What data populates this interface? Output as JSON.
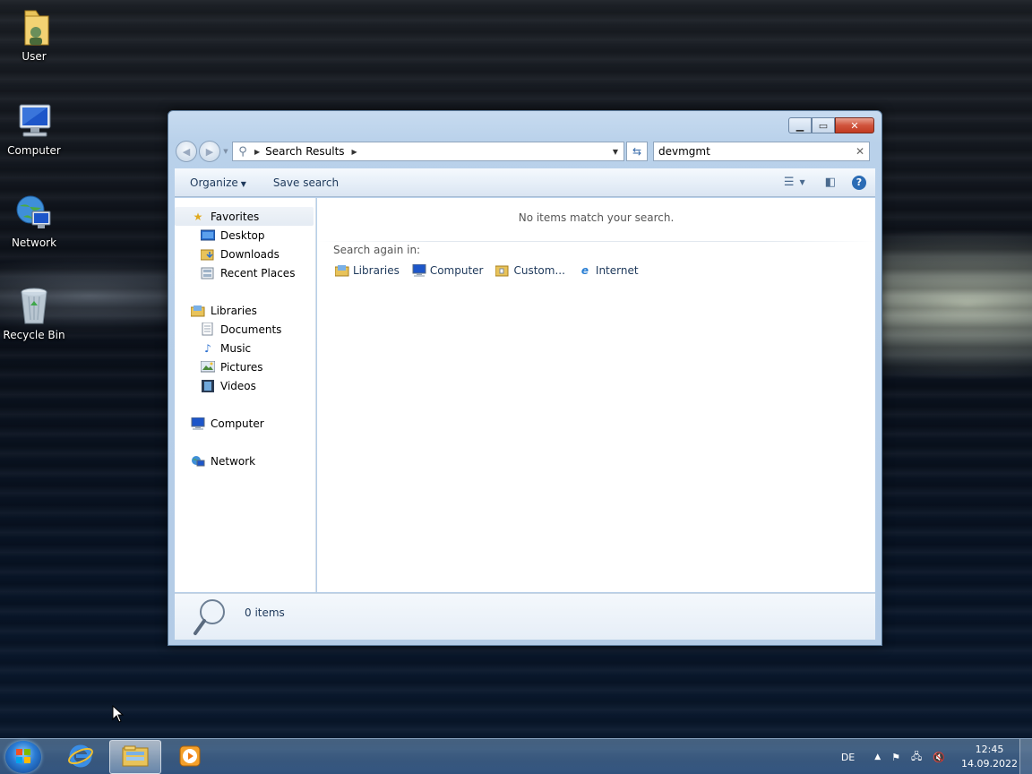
{
  "desktop": {
    "icons": [
      {
        "label": "User",
        "icon": "user-folder-icon"
      },
      {
        "label": "Computer",
        "icon": "computer-icon"
      },
      {
        "label": "Network",
        "icon": "network-icon"
      },
      {
        "label": "Recycle Bin",
        "icon": "recycle-bin-icon"
      }
    ]
  },
  "window": {
    "address": {
      "segment": "Search Results"
    },
    "search": {
      "value": "devmgmt"
    },
    "toolbar": {
      "organize": "Organize",
      "save_search": "Save search"
    },
    "nav": {
      "favorites": "Favorites",
      "desktop": "Desktop",
      "downloads": "Downloads",
      "recent_places": "Recent Places",
      "libraries": "Libraries",
      "documents": "Documents",
      "music": "Music",
      "pictures": "Pictures",
      "videos": "Videos",
      "computer": "Computer",
      "network": "Network"
    },
    "content": {
      "empty_message": "No items match your search.",
      "search_again": "Search again in:",
      "locations": [
        {
          "label": "Libraries",
          "icon": "libraries-icon"
        },
        {
          "label": "Computer",
          "icon": "computer-icon"
        },
        {
          "label": "Custom...",
          "icon": "custom-folder-icon"
        },
        {
          "label": "Internet",
          "icon": "internet-explorer-icon"
        }
      ]
    },
    "details": {
      "count": "0 items"
    }
  },
  "taskbar": {
    "language": "DE",
    "time": "12:45",
    "date": "14.09.2022"
  },
  "colors": {
    "accent": "#2b6cb5",
    "close_button": "#c13b22",
    "link_text": "#1e395b"
  }
}
